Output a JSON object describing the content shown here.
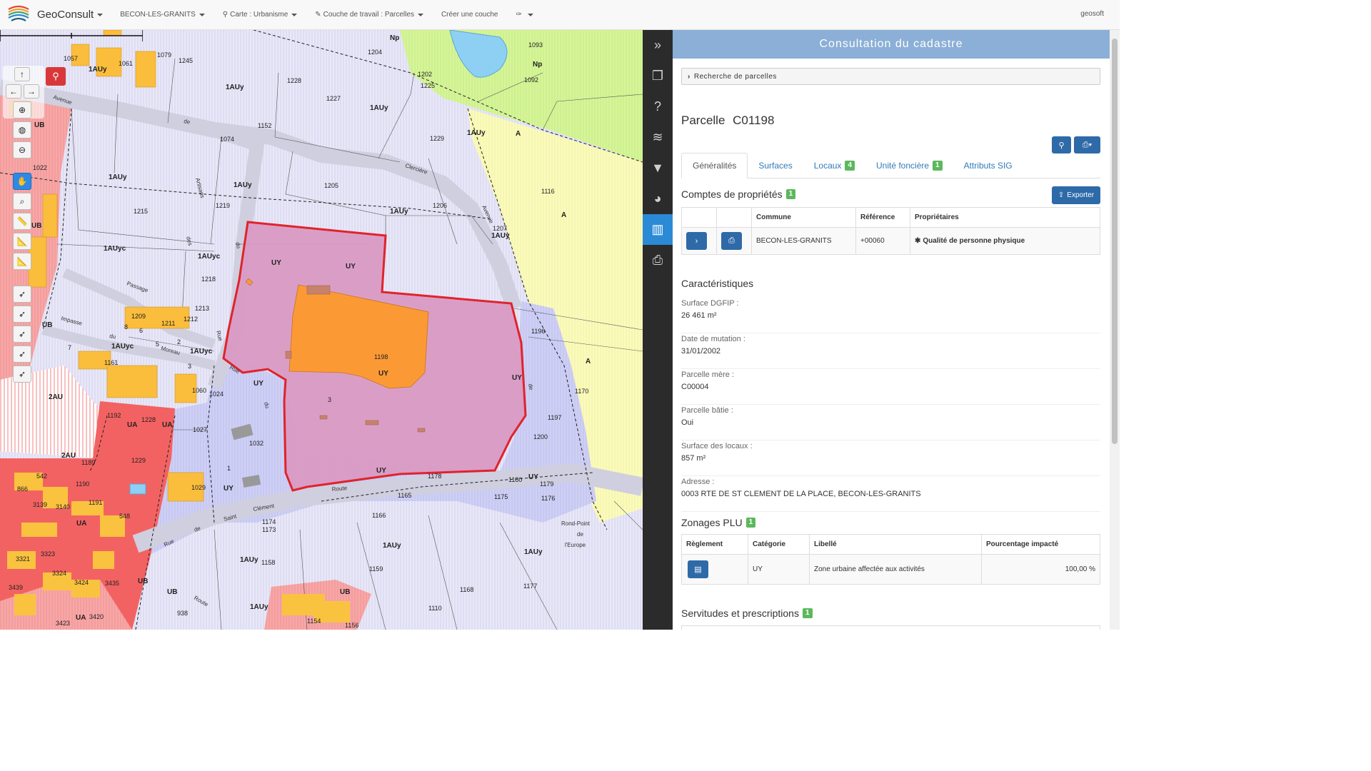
{
  "app": {
    "brand": "GeoConsult",
    "commune": "BECON-LES-GRANITS",
    "map_menu": "Carte : Urbanisme",
    "layer_menu": "Couche de travail : Parcelles",
    "create_layer": "Créer une couche",
    "user": "geosoft"
  },
  "panel": {
    "title": "Consultation du cadastre",
    "search_label": "Recherche de parcelles",
    "parcel_prefix": "Parcelle",
    "parcel_id": "C01198",
    "tabs": [
      {
        "label": "Généralités",
        "badge": ""
      },
      {
        "label": "Surfaces",
        "badge": ""
      },
      {
        "label": "Locaux",
        "badge": "4"
      },
      {
        "label": "Unité foncière",
        "badge": "1"
      },
      {
        "label": "Attributs SIG",
        "badge": ""
      }
    ],
    "owners": {
      "heading": "Comptes de propriétés",
      "count": "1",
      "export_label": "Exporter",
      "columns": [
        "",
        "",
        "Commune",
        "Référence",
        "Propriétaires"
      ],
      "rows": [
        {
          "commune": "BECON-LES-GRANITS",
          "reference": "+00060",
          "owner": "Qualité de personne physique"
        }
      ]
    },
    "characteristics": {
      "heading": "Caractéristiques",
      "items": [
        {
          "label": "Surface DGFIP :",
          "value": "26 461 m²"
        },
        {
          "label": "Date de mutation :",
          "value": "31/01/2002"
        },
        {
          "label": "Parcelle mère :",
          "value": "C00004"
        },
        {
          "label": "Parcelle bâtie :",
          "value": "Oui"
        },
        {
          "label": "Surface des locaux :",
          "value": "857 m²"
        },
        {
          "label": "Adresse :",
          "value": "0003 RTE DE ST CLEMENT DE LA PLACE, BECON-LES-GRANITS"
        }
      ]
    },
    "plu": {
      "heading": "Zonages PLU",
      "count": "1",
      "columns": [
        "Règlement",
        "Catégorie",
        "Libellé",
        "Pourcentage impacté"
      ],
      "rows": [
        {
          "categorie": "UY",
          "libelle": "Zone urbaine affectée aux activités",
          "pourcentage": "100,00 %"
        }
      ]
    },
    "servitudes": {
      "heading": "Servitudes et prescriptions",
      "count": "1"
    }
  },
  "map": {
    "zones": [
      "UY",
      "UY",
      "UY",
      "UY",
      "UY",
      "1AUy",
      "1AUy",
      "1AUy",
      "1AUy",
      "1AUy",
      "1AUy",
      "1AUy",
      "1AUy",
      "1AUy",
      "1AUyc",
      "1AUyc",
      "1AUyc",
      "1AUyc",
      "UB",
      "UB",
      "UB",
      "UB",
      "UB",
      "UA",
      "UA",
      "UA",
      "UA",
      "2AU",
      "2AU",
      "A",
      "A",
      "A",
      "Np",
      "Np"
    ],
    "parcels": [
      "1057",
      "1061",
      "1079",
      "1245",
      "1204",
      "1093",
      "1092",
      "1202",
      "1225",
      "1228",
      "1227",
      "1152",
      "1074",
      "1229",
      "1116",
      "1205",
      "1206",
      "1207",
      "1219",
      "1215",
      "1218",
      "1213",
      "1209",
      "1211",
      "1212",
      "1161",
      "1060",
      "1024",
      "1027",
      "1032",
      "1029",
      "1198",
      "1196",
      "1197",
      "1200",
      "1170",
      "1178",
      "1180",
      "1179",
      "1176",
      "1175",
      "1165",
      "1166",
      "1174",
      "1173",
      "1159",
      "1158",
      "1168",
      "1177",
      "1110",
      "1154",
      "1156",
      "1022",
      "1192",
      "1228",
      "1189",
      "1229",
      "1190",
      "1191",
      "542",
      "866",
      "3139",
      "3140",
      "548",
      "3321",
      "3323",
      "3324",
      "3424",
      "3435",
      "3439",
      "3420",
      "3423",
      "938"
    ],
    "streets": [
      "Avenue",
      "de",
      "Clercière",
      "Artisans",
      "des",
      "du",
      "Avenue",
      "Passage",
      "Impasse",
      "du",
      "Moreau",
      "Rue",
      "Rue",
      "du",
      "Route",
      "de",
      "Saint",
      "Clément",
      "Rue",
      "de",
      "Route",
      "Rond-Point",
      "de",
      "l'Europe"
    ],
    "misc_numbers": [
      "8",
      "6",
      "2",
      "5",
      "7",
      "3",
      "1",
      "3"
    ]
  }
}
